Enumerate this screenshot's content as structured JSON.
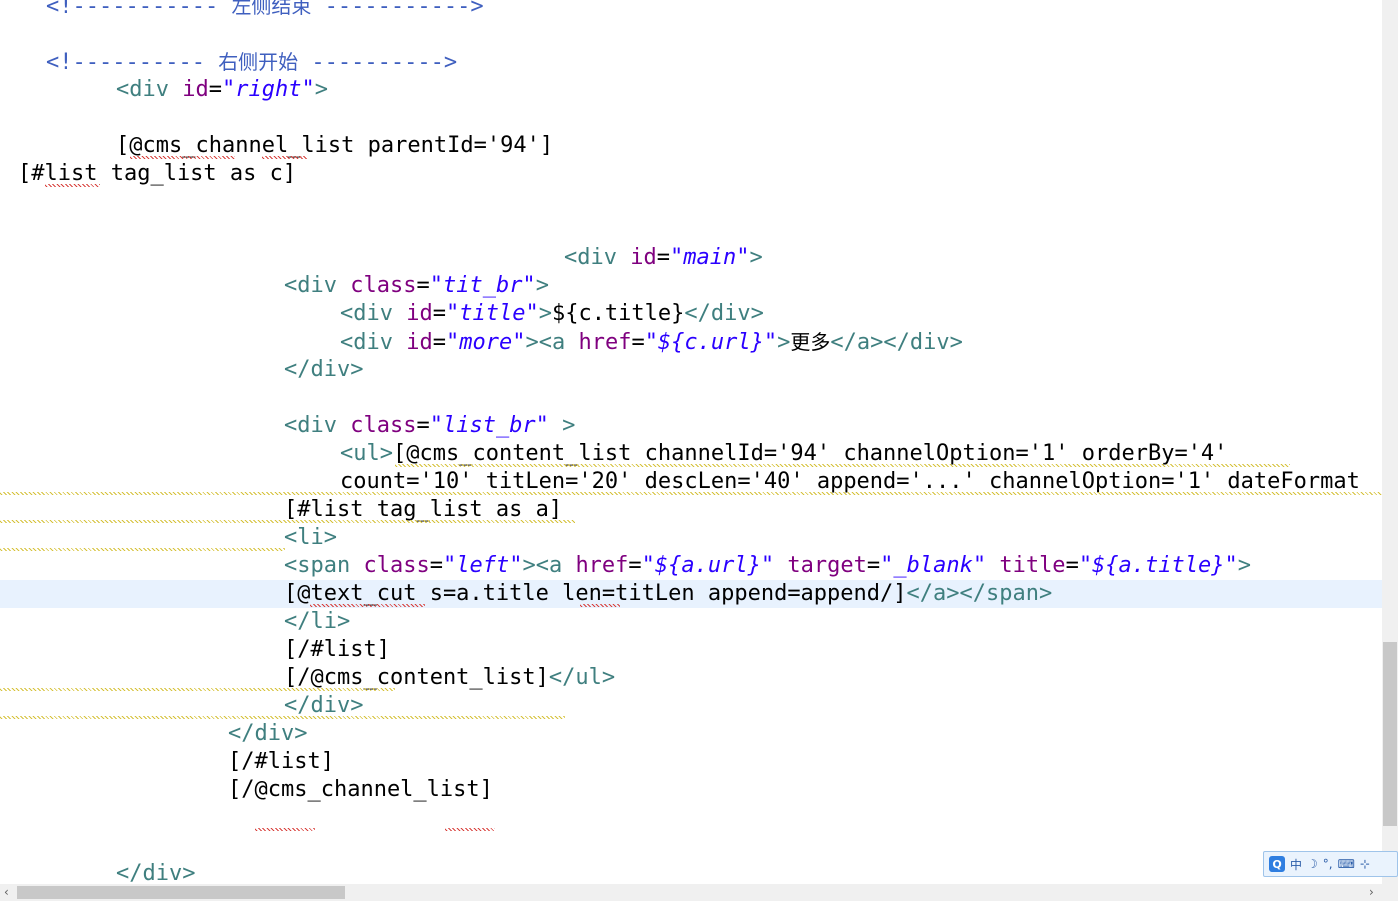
{
  "code_lines": [
    {
      "indent": 3,
      "spans": [
        {
          "c": "cmt",
          "t": "<!----------- "
        },
        {
          "c": "cmt-cjk",
          "t": "左侧结束"
        },
        {
          "c": "cmt",
          "t": " ----------->"
        }
      ]
    },
    {
      "indent": 0,
      "spans": []
    },
    {
      "indent": 3,
      "spans": [
        {
          "c": "cmt",
          "t": "<!---------- "
        },
        {
          "c": "cmt-cjk",
          "t": "右侧开始"
        },
        {
          "c": "cmt",
          "t": " ---------->"
        }
      ]
    },
    {
      "indent": 8,
      "spans": [
        {
          "c": "tag",
          "t": "<div "
        },
        {
          "c": "attr",
          "t": "id"
        },
        {
          "c": "txt",
          "t": "="
        },
        {
          "c": "val",
          "t": "\"right\""
        },
        {
          "c": "tag",
          "t": ">"
        }
      ]
    },
    {
      "indent": 0,
      "spans": []
    },
    {
      "indent": 8,
      "spans": [
        {
          "c": "txt",
          "t": "[@cms_channel_list parentId='94']"
        }
      ]
    },
    {
      "indent": 1,
      "spans": [
        {
          "c": "txt",
          "t": "[#list tag_list as c]"
        }
      ]
    },
    {
      "indent": 0,
      "spans": []
    },
    {
      "indent": 0,
      "spans": []
    },
    {
      "indent": 40,
      "spans": [
        {
          "c": "tag",
          "t": "<div "
        },
        {
          "c": "attr",
          "t": "id"
        },
        {
          "c": "txt",
          "t": "="
        },
        {
          "c": "val",
          "t": "\"main\""
        },
        {
          "c": "tag",
          "t": ">"
        }
      ]
    },
    {
      "indent": 20,
      "spans": [
        {
          "c": "tag",
          "t": "<div "
        },
        {
          "c": "attr",
          "t": "class"
        },
        {
          "c": "txt",
          "t": "="
        },
        {
          "c": "val",
          "t": "\"tit_br\""
        },
        {
          "c": "tag",
          "t": ">"
        }
      ]
    },
    {
      "indent": 24,
      "spans": [
        {
          "c": "tag",
          "t": "<div "
        },
        {
          "c": "attr",
          "t": "id"
        },
        {
          "c": "txt",
          "t": "="
        },
        {
          "c": "val",
          "t": "\"title\""
        },
        {
          "c": "tag",
          "t": ">"
        },
        {
          "c": "txt",
          "t": "${c.title}"
        },
        {
          "c": "tag",
          "t": "</div>"
        }
      ]
    },
    {
      "indent": 24,
      "spans": [
        {
          "c": "tag",
          "t": "<div "
        },
        {
          "c": "attr",
          "t": "id"
        },
        {
          "c": "txt",
          "t": "="
        },
        {
          "c": "val",
          "t": "\"more\""
        },
        {
          "c": "tag",
          "t": "><a "
        },
        {
          "c": "attr",
          "t": "href"
        },
        {
          "c": "txt",
          "t": "="
        },
        {
          "c": "val",
          "t": "\"${c.url}\""
        },
        {
          "c": "tag",
          "t": ">"
        },
        {
          "c": "cjk",
          "t": "更多"
        },
        {
          "c": "tag",
          "t": "</a></div>"
        }
      ]
    },
    {
      "indent": 20,
      "spans": [
        {
          "c": "tag",
          "t": "</div>"
        }
      ]
    },
    {
      "indent": 0,
      "spans": []
    },
    {
      "indent": 20,
      "spans": [
        {
          "c": "tag",
          "t": "<div "
        },
        {
          "c": "attr",
          "t": "class"
        },
        {
          "c": "txt",
          "t": "="
        },
        {
          "c": "val",
          "t": "\"list_br\""
        },
        {
          "c": "tag",
          "t": " >"
        }
      ]
    },
    {
      "indent": 24,
      "spans": [
        {
          "c": "tag",
          "t": "<ul>"
        },
        {
          "c": "txt",
          "t": "[@cms_content_list channelId='94' channelOption='1' orderBy='4'"
        }
      ]
    },
    {
      "indent": 24,
      "spans": [
        {
          "c": "txt",
          "t": "count='10' titLen='20' descLen='40' append='...' channelOption='1' dateFormat"
        }
      ]
    },
    {
      "indent": 20,
      "spans": [
        {
          "c": "txt",
          "t": "[#list tag_list as a]"
        }
      ]
    },
    {
      "indent": 20,
      "spans": [
        {
          "c": "tag",
          "t": "<li>"
        }
      ]
    },
    {
      "indent": 20,
      "spans": [
        {
          "c": "tag",
          "t": "<span "
        },
        {
          "c": "attr",
          "t": "class"
        },
        {
          "c": "txt",
          "t": "="
        },
        {
          "c": "val",
          "t": "\"left\""
        },
        {
          "c": "tag",
          "t": "><a "
        },
        {
          "c": "attr",
          "t": "href"
        },
        {
          "c": "txt",
          "t": "="
        },
        {
          "c": "val",
          "t": "\"${a.url}\""
        },
        {
          "c": "txt",
          "t": " "
        },
        {
          "c": "attr",
          "t": "target"
        },
        {
          "c": "txt",
          "t": "="
        },
        {
          "c": "val",
          "t": "\"_blank\""
        },
        {
          "c": "txt",
          "t": " "
        },
        {
          "c": "attr",
          "t": "title"
        },
        {
          "c": "txt",
          "t": "="
        },
        {
          "c": "val",
          "t": "\"${a.title}\""
        },
        {
          "c": "tag",
          "t": ">"
        }
      ]
    },
    {
      "indent": 20,
      "current": true,
      "spans": [
        {
          "c": "txt",
          "t": "[@text_cut s=a.title len=titLen append=append/]"
        },
        {
          "c": "tag",
          "t": "</a></span>"
        }
      ]
    },
    {
      "indent": 20,
      "spans": [
        {
          "c": "tag",
          "t": "</li>"
        }
      ]
    },
    {
      "indent": 20,
      "spans": [
        {
          "c": "txt",
          "t": "[/#list]"
        }
      ]
    },
    {
      "indent": 20,
      "spans": [
        {
          "c": "txt",
          "t": "[/@cms_content_list]"
        },
        {
          "c": "tag",
          "t": "</ul>"
        }
      ]
    },
    {
      "indent": 20,
      "spans": [
        {
          "c": "tag",
          "t": "</div>"
        }
      ]
    },
    {
      "indent": 16,
      "spans": [
        {
          "c": "tag",
          "t": "</div>"
        }
      ]
    },
    {
      "indent": 16,
      "spans": [
        {
          "c": "txt",
          "t": "[/#list]"
        }
      ]
    },
    {
      "indent": 16,
      "spans": [
        {
          "c": "txt",
          "t": "[/@cms_channel_list]"
        }
      ]
    },
    {
      "indent": 0,
      "spans": []
    },
    {
      "indent": 0,
      "spans": []
    },
    {
      "indent": 8,
      "spans": [
        {
          "c": "tag",
          "t": "</div>"
        }
      ]
    }
  ],
  "ime_toolbar": {
    "logo": "Q",
    "mode_label": "中",
    "moon_icon": "☽",
    "punct_label": "°,",
    "keyboard_icon": "⌨",
    "tools_icon": "⊹"
  },
  "scroll": {
    "left_arrow": "‹",
    "right_arrow": "›"
  }
}
